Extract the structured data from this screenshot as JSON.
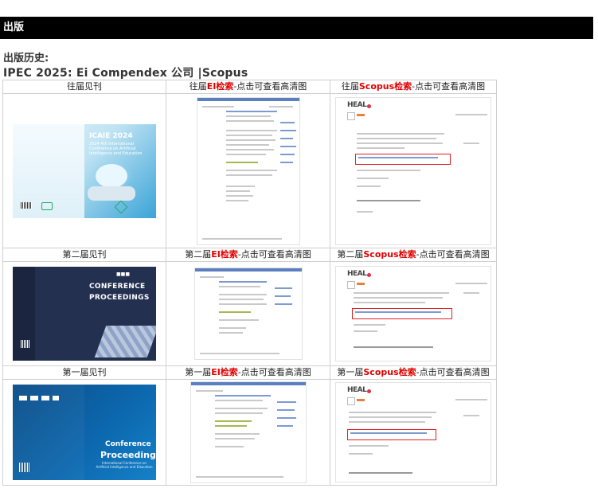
{
  "section_title": "出版",
  "history_label": "出版历史:",
  "publication_line": "IPEC 2025: Ei Compendex 公司 |Scopus",
  "rows": [
    {
      "proceedings_label": "往届见刊",
      "ei": {
        "prefix": "往届",
        "highlight": "EI检索",
        "suffix": "-点击可查看高清图"
      },
      "scopus": {
        "prefix": "往届",
        "highlight": "Scopus检索",
        "suffix": "-点击可查看高清图"
      },
      "cover": {
        "title": "ICAIE 2024",
        "subtitle": "2024 4th International Conference on Artificial Intelligence and Education"
      }
    },
    {
      "proceedings_label": "第二届见刊",
      "ei": {
        "prefix": "第二届",
        "highlight": "EI检索",
        "suffix": "-点击可查看高清图"
      },
      "scopus": {
        "prefix": "第二届",
        "highlight": "Scopus检索",
        "suffix": "-点击可查看高清图"
      },
      "cover": {
        "title_line1": "CONFERENCE",
        "title_line2": "PROCEEDINGS"
      }
    },
    {
      "proceedings_label": "第一届见刊",
      "ei": {
        "prefix": "第一届",
        "highlight": "EI检索",
        "suffix": "-点击可查看高清图"
      },
      "scopus": {
        "prefix": "第一届",
        "highlight": "Scopus检索",
        "suffix": "-点击可查看高清图"
      },
      "cover": {
        "title_line1": "Conference",
        "title_line2": "Proceedings",
        "subtitle": "International Conference on Artificial Intelligence and Education"
      }
    }
  ],
  "scopus_logo": "HEAL",
  "colors": {
    "header_bg": "#000000",
    "highlight": "#e00000",
    "border": "#cfcfcf"
  },
  "icons": [
    "book-cover-image",
    "ei-screenshot-image",
    "scopus-screenshot-image"
  ]
}
